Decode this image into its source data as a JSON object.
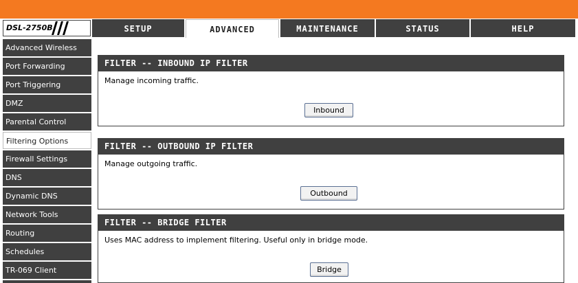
{
  "brand": {
    "model": "DSL-2750B",
    "accent_color": "#f47920"
  },
  "tabs": [
    {
      "label": "SETUP",
      "active": false
    },
    {
      "label": "ADVANCED",
      "active": true
    },
    {
      "label": "MAINTENANCE",
      "active": false
    },
    {
      "label": "STATUS",
      "active": false
    },
    {
      "label": "HELP",
      "active": false
    }
  ],
  "sidebar": {
    "items": [
      {
        "label": "Advanced Wireless",
        "active": false
      },
      {
        "label": "Port Forwarding",
        "active": false
      },
      {
        "label": "Port Triggering",
        "active": false
      },
      {
        "label": "DMZ",
        "active": false
      },
      {
        "label": "Parental Control",
        "active": false
      },
      {
        "label": "Filtering Options",
        "active": true
      },
      {
        "label": "Firewall Settings",
        "active": false
      },
      {
        "label": "DNS",
        "active": false
      },
      {
        "label": "Dynamic DNS",
        "active": false
      },
      {
        "label": "Network Tools",
        "active": false
      },
      {
        "label": "Routing",
        "active": false
      },
      {
        "label": "Schedules",
        "active": false
      },
      {
        "label": "TR-069 Client",
        "active": false
      }
    ]
  },
  "sections": {
    "inbound": {
      "title": "FILTER -- INBOUND IP FILTER",
      "description": "Manage incoming traffic.",
      "button": "Inbound"
    },
    "outbound": {
      "title": "FILTER -- OUTBOUND IP FILTER",
      "description": "Manage outgoing traffic.",
      "button": "Outbound"
    },
    "bridge": {
      "title": "FILTER -- BRIDGE FILTER",
      "description": "Uses MAC address to implement filtering. Useful only in bridge mode.",
      "button": "Bridge"
    }
  }
}
